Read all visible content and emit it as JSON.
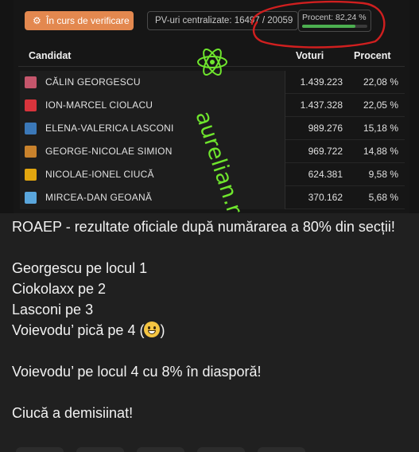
{
  "toolbar": {
    "status_label": "În curs de verificare",
    "pv_label": "PV-uri centralizate: 16497 / 20059",
    "percent_label": "Procent: 82,24 %",
    "percent_value": 82.24
  },
  "table": {
    "headers": {
      "candidate": "Candidat",
      "votes": "Voturi",
      "percent": "Procent"
    },
    "rows": [
      {
        "name": "CĂLIN GEORGESCU",
        "votes": "1.439.223",
        "percent": "22,08 %",
        "color": "#c5566c"
      },
      {
        "name": "ION-MARCEL CIOLACU",
        "votes": "1.437.328",
        "percent": "22,05 %",
        "color": "#d9343c"
      },
      {
        "name": "ELENA-VALERICA LASCONI",
        "votes": "989.276",
        "percent": "15,18 %",
        "color": "#3b78b8"
      },
      {
        "name": "GEORGE-NICOLAE SIMION",
        "votes": "969.722",
        "percent": "14,88 %",
        "color": "#c9822c"
      },
      {
        "name": "NICOLAE-IONEL CIUCĂ",
        "votes": "624.381",
        "percent": "9,58 %",
        "color": "#e2a60f"
      },
      {
        "name": "MIRCEA-DAN GEOANĂ",
        "votes": "370.162",
        "percent": "5,68 %",
        "color": "#5aa6dc"
      }
    ]
  },
  "watermark": {
    "text": "aurelian.ro",
    "color": "#6fe62d"
  },
  "annotation_color": "#d01f1f",
  "post": {
    "line1": "ROAEP - rezultate oficiale după numărarea a 80% din secții!",
    "line2": "Georgescu pe locul 1",
    "line3": "Ciokolaxx pe 2",
    "line4": "Lasconi pe 3",
    "line5_prefix": "Voievodu’ pică pe 4 (",
    "line5_suffix": ")",
    "line6": "Voievodu’ pe locul 4 cu 8% în diasporă!",
    "line7": "Ciucă a demisiinat!"
  }
}
